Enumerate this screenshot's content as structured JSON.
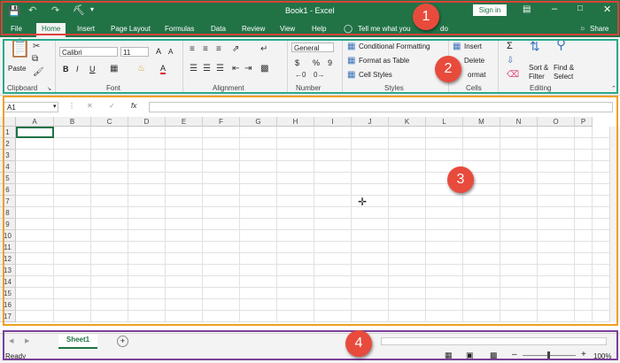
{
  "titlebar": {
    "title": "Book1 - Excel",
    "signin": "Sign in",
    "bg": "#217346"
  },
  "tabs": [
    "File",
    "Home",
    "Insert",
    "Page Layout",
    "Formulas",
    "Data",
    "Review",
    "View",
    "Help"
  ],
  "tellme": "Tell me what you",
  "tellme_tail": "do",
  "share": "Share",
  "ribbon": {
    "clipboard": {
      "paste": "Paste",
      "label": "Clipboard"
    },
    "font": {
      "name": "Calibri",
      "size": "11",
      "label": "Font",
      "bold": "B",
      "italic": "I",
      "underline": "U",
      "grow": "A",
      "shrink": "A",
      "color": "A"
    },
    "alignment": {
      "label": "Alignment"
    },
    "number": {
      "format": "General",
      "currency": "$",
      "percent": "%",
      "comma": "9",
      "label": "Number"
    },
    "styles": {
      "cond": "Conditional Formatting",
      "table": "Format as Table",
      "cell": "Cell Styles",
      "label": "Styles"
    },
    "cells": {
      "insert": "Insert",
      "delete": "Delete",
      "format": "ormat",
      "label": "Cells"
    },
    "editing": {
      "sigma": "Σ",
      "sort": "Sort &",
      "filter": "Filter",
      "find": "Find &",
      "select": "Select",
      "label": "Editing"
    }
  },
  "formula_bar": {
    "namebox": "A1",
    "fx": "fx",
    "cancel": "✕",
    "enter": "✓"
  },
  "columns": [
    "A",
    "B",
    "C",
    "D",
    "E",
    "F",
    "G",
    "H",
    "I",
    "J",
    "K",
    "L",
    "M",
    "N",
    "O",
    "P"
  ],
  "rows": [
    "1",
    "2",
    "3",
    "4",
    "5",
    "6",
    "7",
    "8",
    "9",
    "10",
    "11",
    "12",
    "13",
    "14",
    "15",
    "16",
    "17"
  ],
  "sheet": {
    "name": "Sheet1",
    "add": "+"
  },
  "status": {
    "ready": "Ready",
    "zoom": "100%"
  },
  "callouts": [
    {
      "num": "1",
      "color": "#e0403a"
    },
    {
      "num": "2",
      "color": "#2aa88a"
    },
    {
      "num": "3",
      "color": "#f0a020"
    },
    {
      "num": "4",
      "color": "#7a3f9a"
    }
  ]
}
